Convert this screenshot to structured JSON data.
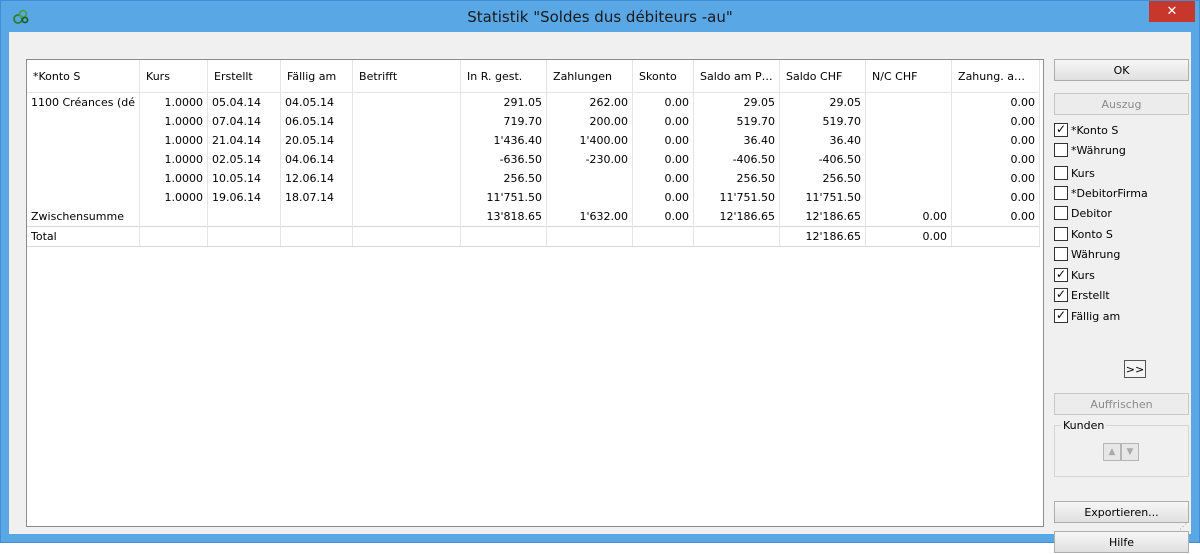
{
  "window": {
    "title": "Statistik \"Soldes dus débiteurs -au\"",
    "close_label": "✕"
  },
  "table": {
    "columns": [
      "*Konto S",
      "Kurs",
      "Erstellt",
      "Fällig am",
      "Betrifft",
      "In R. gest.",
      "Zahlungen",
      "Skonto",
      "Saldo am P…",
      "Saldo CHF",
      "N/C CHF",
      "Zahung. a…"
    ],
    "rows": [
      [
        "1100 Créances (dé",
        "1.0000",
        "05.04.14",
        "04.05.14",
        "",
        "291.05",
        "262.00",
        "0.00",
        "29.05",
        "29.05",
        "",
        "0.00"
      ],
      [
        "",
        "1.0000",
        "07.04.14",
        "06.05.14",
        "",
        "719.70",
        "200.00",
        "0.00",
        "519.70",
        "519.70",
        "",
        "0.00"
      ],
      [
        "",
        "1.0000",
        "21.04.14",
        "20.05.14",
        "",
        "1'436.40",
        "1'400.00",
        "0.00",
        "36.40",
        "36.40",
        "",
        "0.00"
      ],
      [
        "",
        "1.0000",
        "02.05.14",
        "04.06.14",
        "",
        "-636.50",
        "-230.00",
        "0.00",
        "-406.50",
        "-406.50",
        "",
        "0.00"
      ],
      [
        "",
        "1.0000",
        "10.05.14",
        "12.06.14",
        "",
        "256.50",
        "",
        "0.00",
        "256.50",
        "256.50",
        "",
        "0.00"
      ],
      [
        "",
        "1.0000",
        "19.06.14",
        "18.07.14",
        "",
        "11'751.50",
        "",
        "0.00",
        "11'751.50",
        "11'751.50",
        "",
        "0.00"
      ],
      [
        "Zwischensumme",
        "",
        "",
        "",
        "",
        "13'818.65",
        "1'632.00",
        "0.00",
        "12'186.65",
        "12'186.65",
        "0.00",
        "0.00"
      ]
    ],
    "total_row": [
      "Total",
      "",
      "",
      "",
      "",
      "",
      "",
      "",
      "",
      "12'186.65",
      "0.00",
      ""
    ]
  },
  "side": {
    "ok": "OK",
    "auszug": "Auszug",
    "checkboxes": [
      {
        "label": "*Konto S",
        "checked": true
      },
      {
        "label": "*Währung",
        "checked": false
      },
      {
        "label": "Kurs",
        "checked": false
      },
      {
        "label": "*DebitorFirma",
        "checked": false
      },
      {
        "label": "Debitor",
        "checked": false
      },
      {
        "label": "Konto S",
        "checked": false
      },
      {
        "label": "Währung",
        "checked": false
      },
      {
        "label": "Kurs",
        "checked": true
      },
      {
        "label": "Erstellt",
        "checked": true
      },
      {
        "label": "Fällig am",
        "checked": true
      }
    ],
    "more": ">>",
    "auffrischen": "Auffrischen",
    "kunden": "Kunden",
    "exportieren": "Exportieren...",
    "hilfe": "Hilfe"
  },
  "colors": {
    "titlebar": "#5aa7e6",
    "close": "#c7372c"
  }
}
